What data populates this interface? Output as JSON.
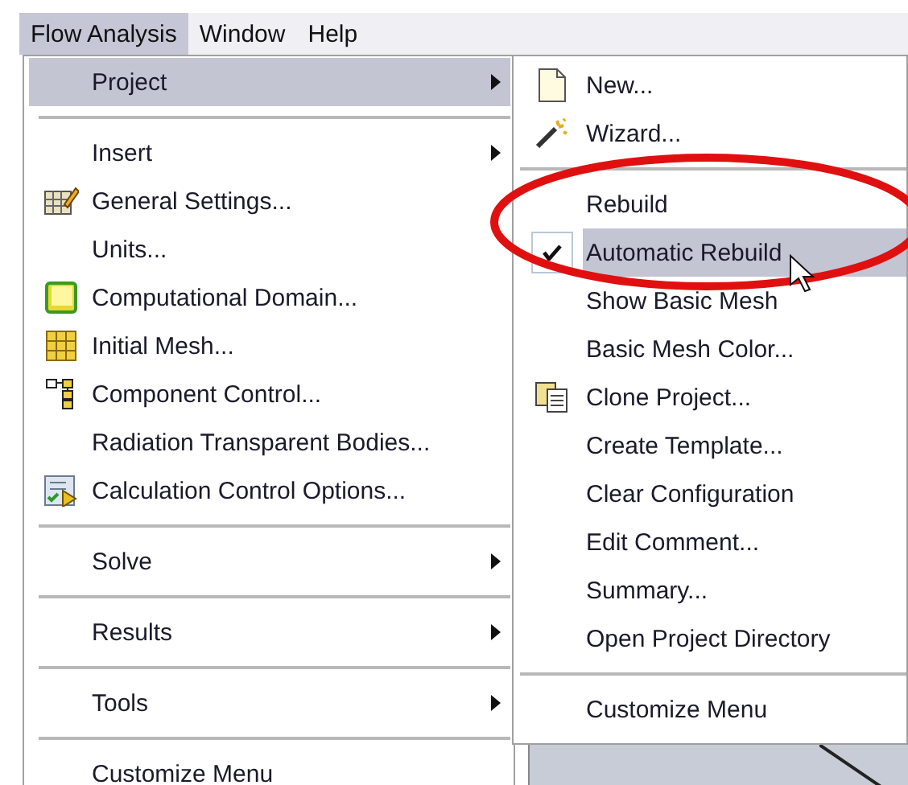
{
  "menubar": [
    {
      "label": "Flow Analysis",
      "selected": true
    },
    {
      "label": "Window",
      "selected": false
    },
    {
      "label": "Help",
      "selected": false
    }
  ],
  "menu": {
    "items": [
      {
        "kind": "item",
        "label": "Project",
        "submenu": true,
        "selected": true
      },
      {
        "kind": "separator"
      },
      {
        "kind": "item",
        "label": "Insert",
        "submenu": true,
        "selected": false
      },
      {
        "kind": "item",
        "label": "General Settings...",
        "submenu": false,
        "selected": false
      },
      {
        "kind": "item",
        "label": "Units...",
        "submenu": false,
        "selected": false
      },
      {
        "kind": "item",
        "label": "Computational Domain...",
        "submenu": false,
        "selected": false
      },
      {
        "kind": "item",
        "label": "Initial Mesh...",
        "submenu": false,
        "selected": false
      },
      {
        "kind": "item",
        "label": "Component Control...",
        "submenu": false,
        "selected": false
      },
      {
        "kind": "item",
        "label": "Radiation Transparent Bodies...",
        "submenu": false,
        "selected": false
      },
      {
        "kind": "item",
        "label": "Calculation Control Options...",
        "submenu": false,
        "selected": false
      },
      {
        "kind": "separator"
      },
      {
        "kind": "item",
        "label": "Solve",
        "submenu": true,
        "selected": false
      },
      {
        "kind": "separator"
      },
      {
        "kind": "item",
        "label": "Results",
        "submenu": true,
        "selected": false
      },
      {
        "kind": "separator"
      },
      {
        "kind": "item",
        "label": "Tools",
        "submenu": true,
        "selected": false
      },
      {
        "kind": "separator"
      },
      {
        "kind": "item",
        "label": "Customize Menu",
        "submenu": false,
        "selected": false
      }
    ]
  },
  "submenu": {
    "items": [
      {
        "kind": "item",
        "label": "New...",
        "checked": false,
        "selected": false
      },
      {
        "kind": "item",
        "label": "Wizard...",
        "checked": false,
        "selected": false
      },
      {
        "kind": "separator"
      },
      {
        "kind": "item",
        "label": "Rebuild",
        "checked": false,
        "selected": false
      },
      {
        "kind": "item",
        "label": "Automatic Rebuild",
        "checked": true,
        "selected": true
      },
      {
        "kind": "item",
        "label": "Show Basic Mesh",
        "checked": false,
        "selected": false
      },
      {
        "kind": "item",
        "label": "Basic Mesh Color...",
        "checked": false,
        "selected": false
      },
      {
        "kind": "item",
        "label": "Clone Project...",
        "checked": false,
        "selected": false
      },
      {
        "kind": "item",
        "label": "Create Template...",
        "checked": false,
        "selected": false
      },
      {
        "kind": "item",
        "label": "Clear Configuration",
        "checked": false,
        "selected": false
      },
      {
        "kind": "item",
        "label": "Edit Comment...",
        "checked": false,
        "selected": false
      },
      {
        "kind": "item",
        "label": "Summary...",
        "checked": false,
        "selected": false
      },
      {
        "kind": "item",
        "label": "Open Project Directory",
        "checked": false,
        "selected": false
      },
      {
        "kind": "separator"
      },
      {
        "kind": "item",
        "label": "Customize Menu",
        "checked": false,
        "selected": false
      }
    ]
  }
}
